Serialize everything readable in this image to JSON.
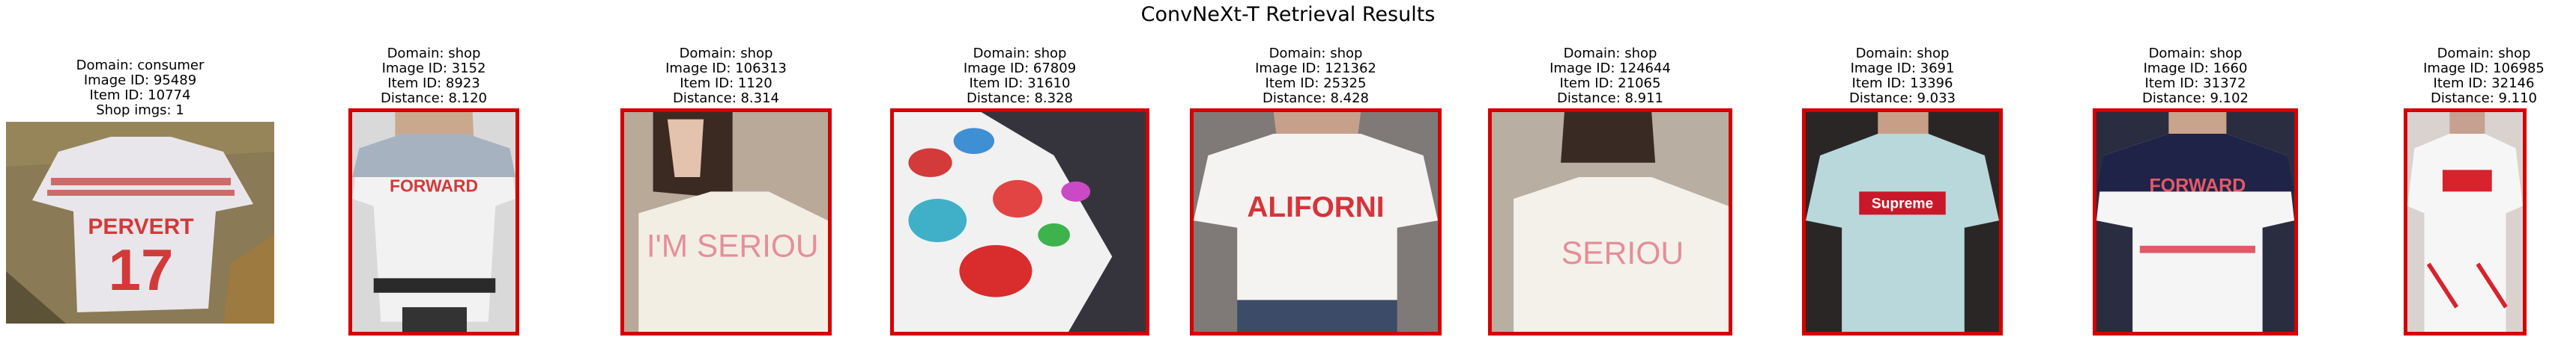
{
  "title": "ConvNeXt-T Retrieval Results",
  "query": {
    "lines": [
      "Domain: consumer",
      "Image ID: 95489",
      "Item ID: 10774",
      "Shop imgs: 1"
    ],
    "image_text": [
      "PERVERT",
      "17"
    ]
  },
  "results": [
    {
      "lines": [
        "Domain: shop",
        "Image ID: 3152",
        "Item ID: 8923",
        "Distance: 8.120"
      ],
      "image_text": "FORWARD"
    },
    {
      "lines": [
        "Domain: shop",
        "Image ID: 106313",
        "Item ID: 1120",
        "Distance: 8.314"
      ],
      "image_text": "I'M SERIOU"
    },
    {
      "lines": [
        "Domain: shop",
        "Image ID: 67809",
        "Item ID: 31610",
        "Distance: 8.328"
      ],
      "image_text": ""
    },
    {
      "lines": [
        "Domain: shop",
        "Image ID: 121362",
        "Item ID: 25325",
        "Distance: 8.428"
      ],
      "image_text": "ALIFORNI"
    },
    {
      "lines": [
        "Domain: shop",
        "Image ID: 124644",
        "Item ID: 21065",
        "Distance: 8.911"
      ],
      "image_text": "SERIOU"
    },
    {
      "lines": [
        "Domain: shop",
        "Image ID: 3691",
        "Item ID: 13396",
        "Distance: 9.033"
      ],
      "image_text": "Supreme"
    },
    {
      "lines": [
        "Domain: shop",
        "Image ID: 1660",
        "Item ID: 31372",
        "Distance: 9.102"
      ],
      "image_text": "FORWARD"
    },
    {
      "lines": [
        "Domain: shop",
        "Image ID: 106985",
        "Item ID: 32146",
        "Distance: 9.110"
      ],
      "image_text": ""
    }
  ],
  "colors": {
    "match_border": "#d40000"
  }
}
